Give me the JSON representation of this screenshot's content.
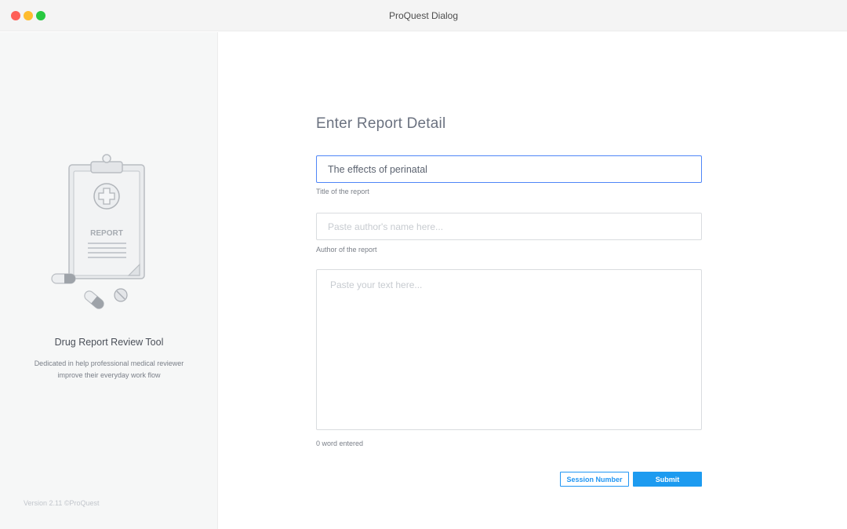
{
  "window": {
    "title": "ProQuest Dialog"
  },
  "sidebar": {
    "illustration_label": "REPORT",
    "tool_title": "Drug Report Review Tool",
    "description": "Dedicated in help professional medical reviewer improve their everyday work flow",
    "version": "Version 2.11  ©ProQuest"
  },
  "form": {
    "heading": "Enter Report Detail",
    "title_value": "The effects of perinatal",
    "title_caption": "Title of the report",
    "author_placeholder": "Paste author's name here...",
    "author_caption": "Author of the report",
    "text_placeholder": "Paste your text here...",
    "word_count": "0 word entered",
    "session_button": "Session Number",
    "submit_button": "Submit"
  },
  "colors": {
    "accent": "#1d9bf0",
    "focus_border": "#4f86f7"
  }
}
